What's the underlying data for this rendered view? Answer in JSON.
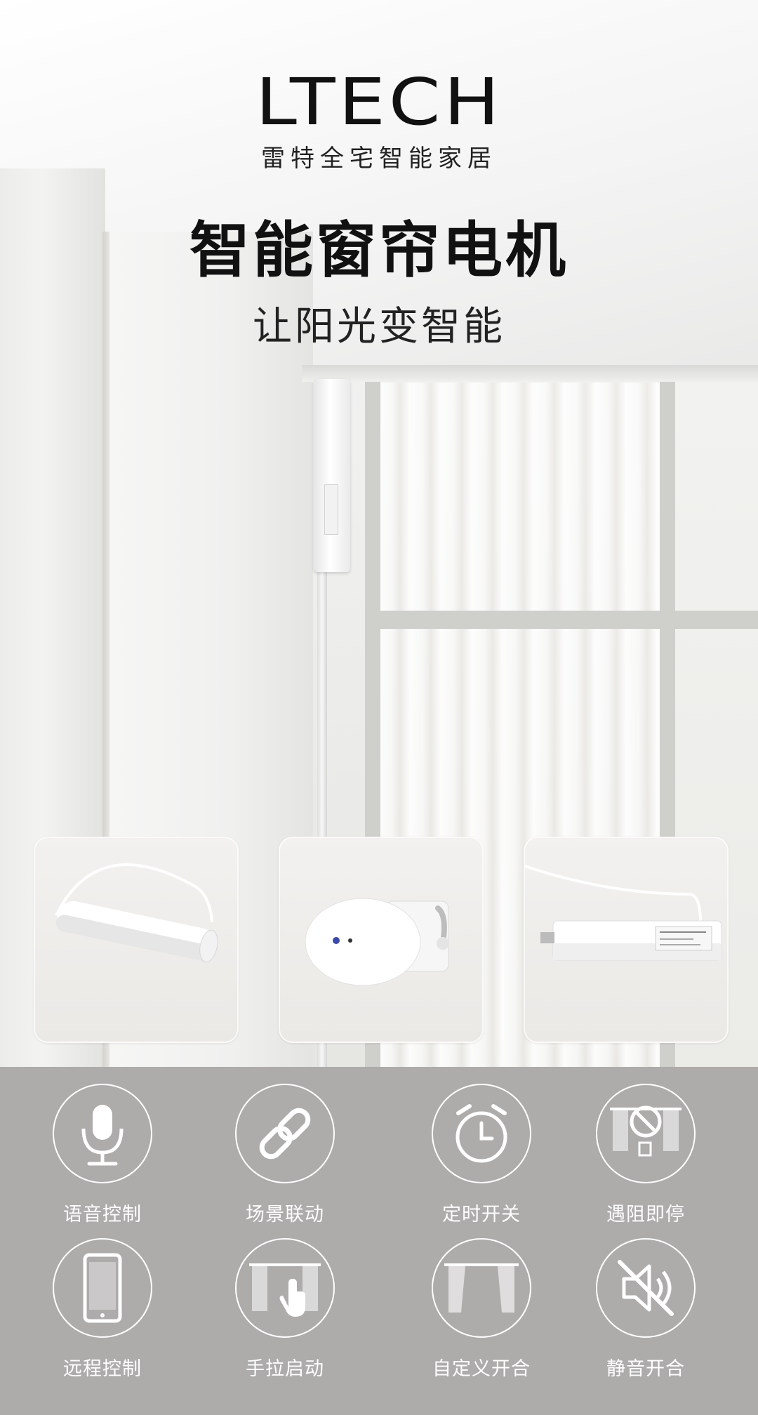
{
  "brand": {
    "logo": "LTECH",
    "subtitle": "雷特全宅智能家居"
  },
  "hero": {
    "title": "智能窗帘电机",
    "tagline": "让阳光变智能"
  },
  "products": [
    {
      "name": "tubular-motor-with-cable"
    },
    {
      "name": "round-wall-controller"
    },
    {
      "name": "curtain-motor-unit"
    }
  ],
  "features": [
    {
      "label": "语音控制",
      "icon": "microphone-icon"
    },
    {
      "label": "场景联动",
      "icon": "chain-link-icon"
    },
    {
      "label": "定时开关",
      "icon": "alarm-clock-icon"
    },
    {
      "label": "遇阻即停",
      "icon": "obstacle-stop-icon"
    },
    {
      "label": "远程控制",
      "icon": "smartphone-icon"
    },
    {
      "label": "手拉启动",
      "icon": "hand-pull-icon"
    },
    {
      "label": "自定义开合",
      "icon": "curtain-open-icon"
    },
    {
      "label": "静音开合",
      "icon": "mute-speaker-icon"
    }
  ],
  "colors": {
    "feature_panel": "#aeabab",
    "text_dark": "#111111",
    "icon_white": "#ffffff"
  }
}
